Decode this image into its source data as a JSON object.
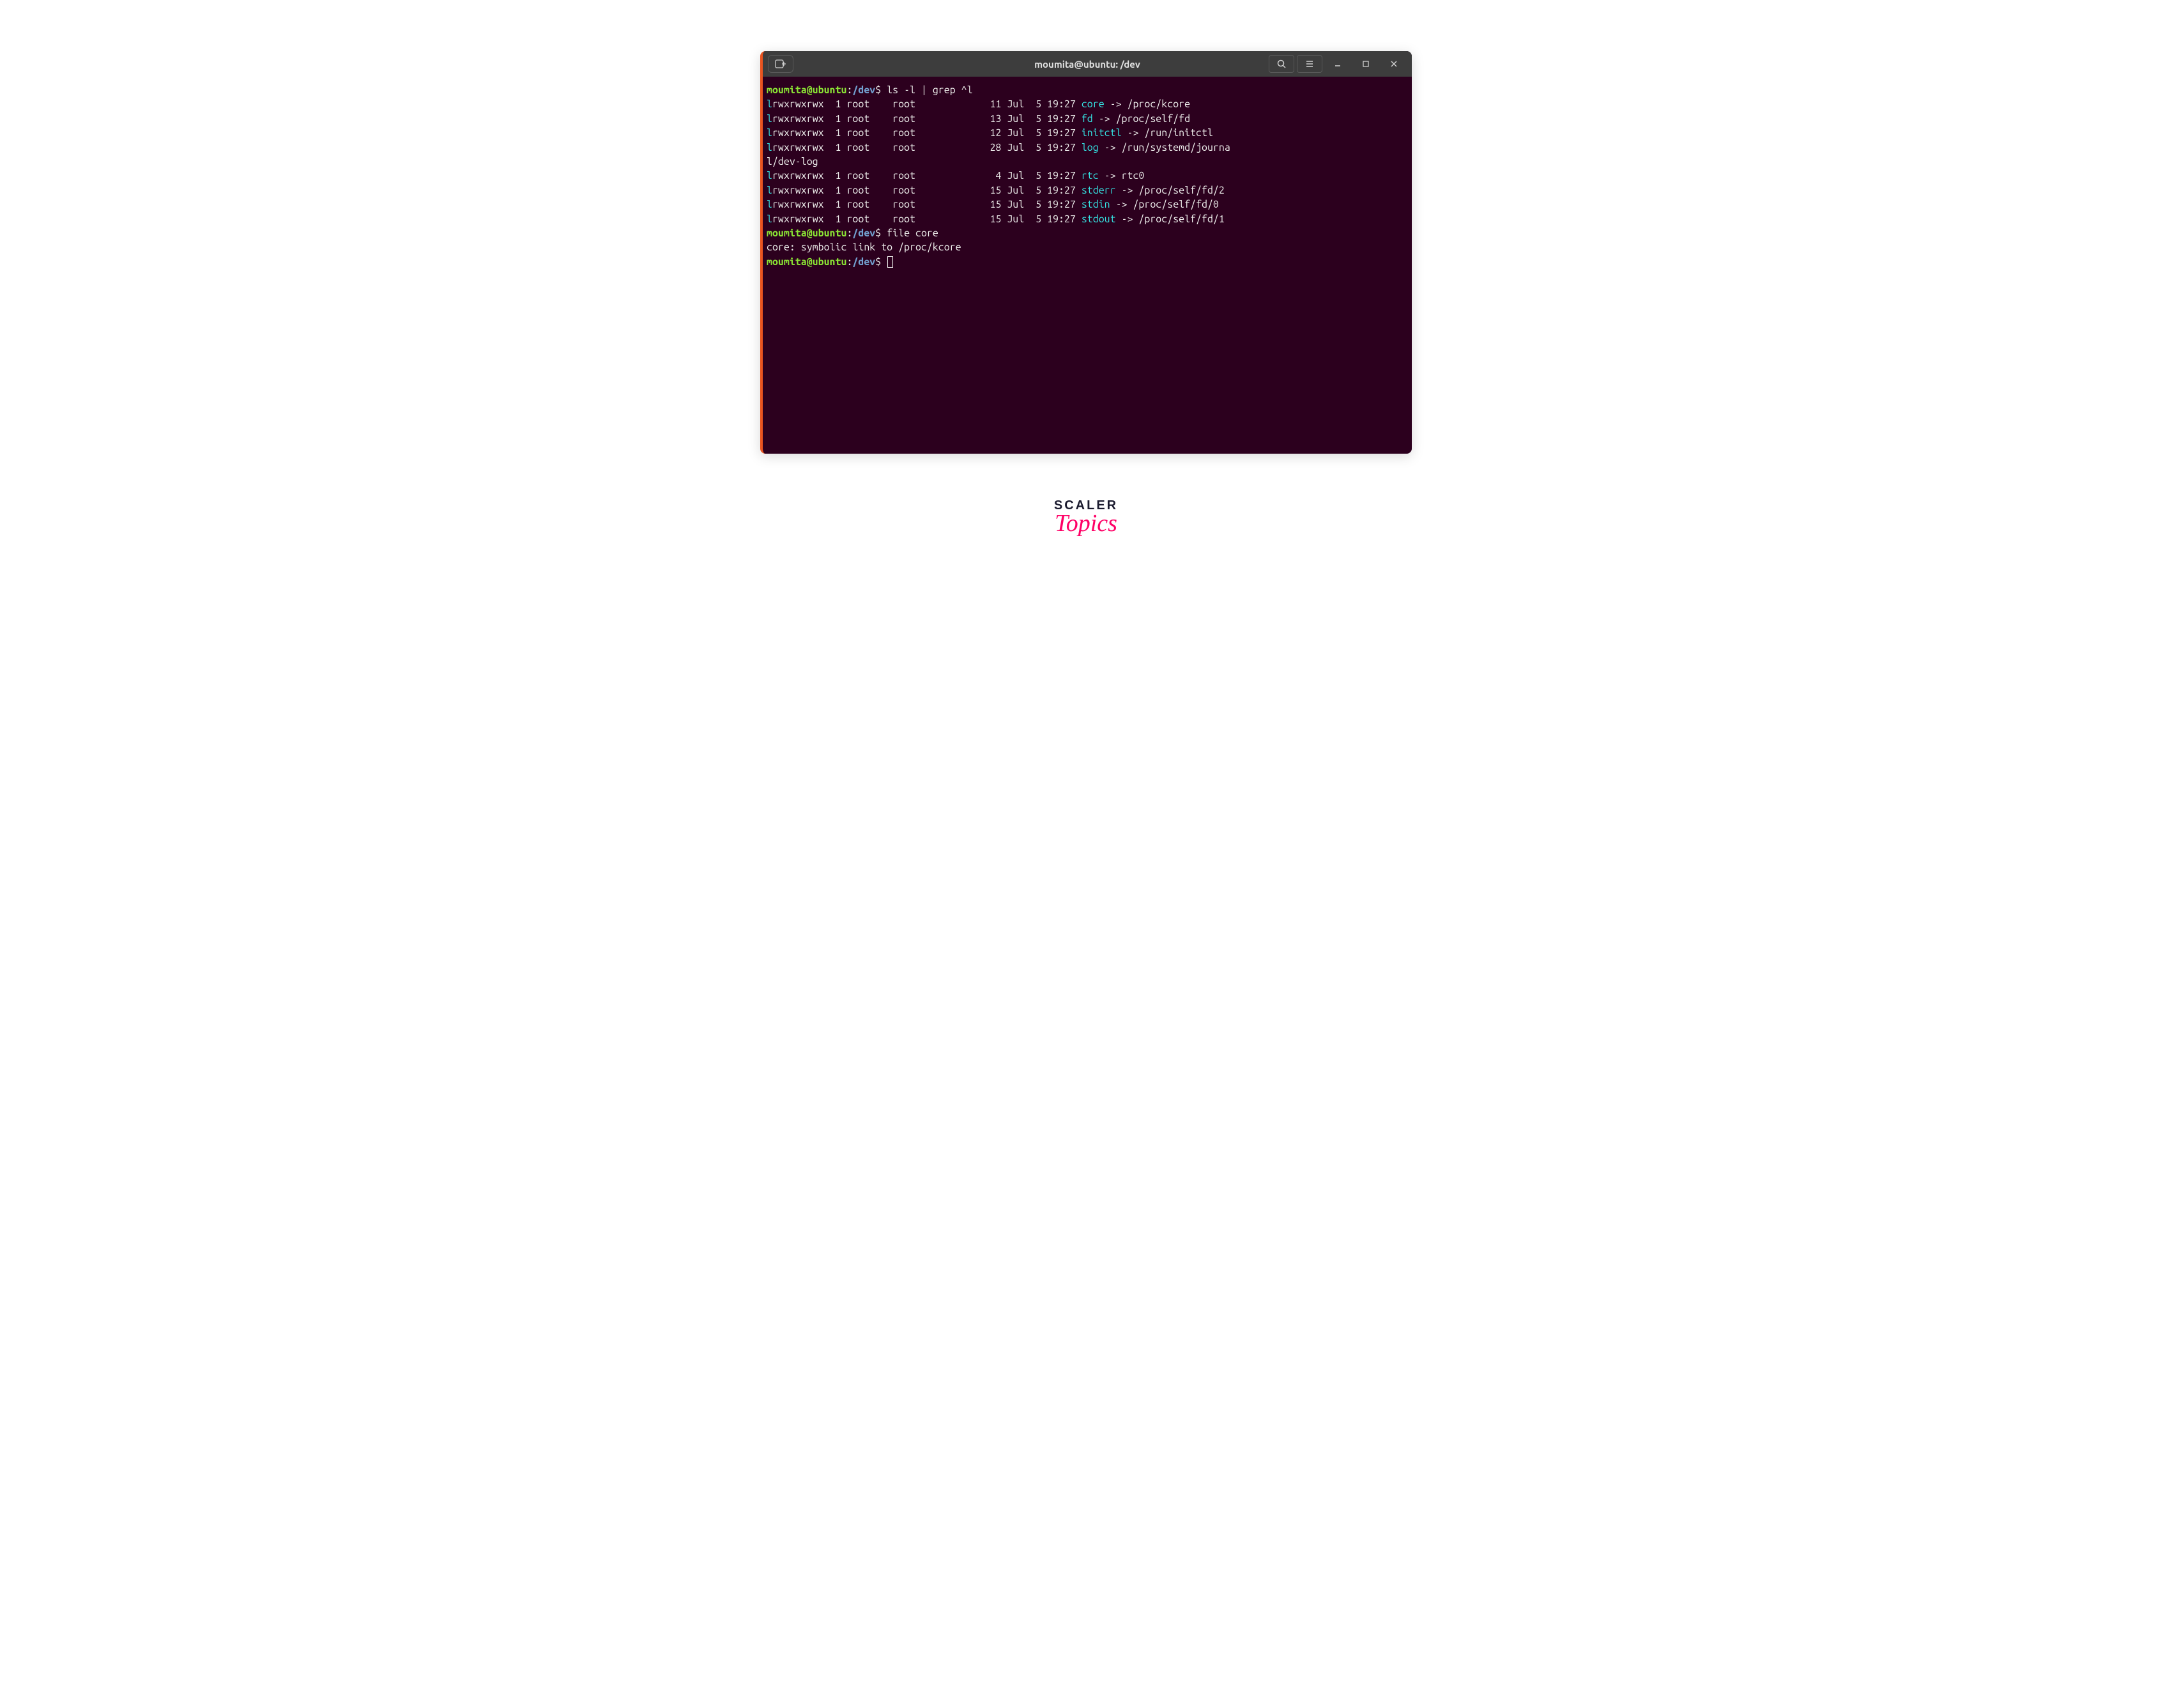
{
  "titlebar": {
    "title": "moumita@ubuntu: /dev",
    "new_tab_icon": "⊕",
    "search_icon": "🔍",
    "menu_icon": "≡",
    "minimize_icon": "—",
    "maximize_icon": "□",
    "close_icon": "✕"
  },
  "prompt": {
    "user_host": "moumita@ubuntu",
    "colon": ":",
    "path": "/dev",
    "dollar": "$"
  },
  "commands": {
    "cmd1": "ls -l | grep ^l",
    "cmd2": "file core"
  },
  "ls_rows": [
    {
      "type": "l",
      "perms": "rwxrwxrwx",
      "links": "1",
      "owner": "root",
      "group": "root",
      "size": "11",
      "month": "Jul",
      "day": "5",
      "time": "19:27",
      "name": "core",
      "arrow": "->",
      "target": "/proc/kcore"
    },
    {
      "type": "l",
      "perms": "rwxrwxrwx",
      "links": "1",
      "owner": "root",
      "group": "root",
      "size": "13",
      "month": "Jul",
      "day": "5",
      "time": "19:27",
      "name": "fd",
      "arrow": "->",
      "target": "/proc/self/fd"
    },
    {
      "type": "l",
      "perms": "rwxrwxrwx",
      "links": "1",
      "owner": "root",
      "group": "root",
      "size": "12",
      "month": "Jul",
      "day": "5",
      "time": "19:27",
      "name": "initctl",
      "arrow": "->",
      "target": "/run/initctl"
    },
    {
      "type": "l",
      "perms": "rwxrwxrwx",
      "links": "1",
      "owner": "root",
      "group": "root",
      "size": "28",
      "month": "Jul",
      "day": "5",
      "time": "19:27",
      "name": "log",
      "arrow": "->",
      "target": "/run/systemd/journa",
      "wrap": "l/dev-log"
    },
    {
      "type": "l",
      "perms": "rwxrwxrwx",
      "links": "1",
      "owner": "root",
      "group": "root",
      "size": "4",
      "month": "Jul",
      "day": "5",
      "time": "19:27",
      "name": "rtc",
      "arrow": "->",
      "target": "rtc0"
    },
    {
      "type": "l",
      "perms": "rwxrwxrwx",
      "links": "1",
      "owner": "root",
      "group": "root",
      "size": "15",
      "month": "Jul",
      "day": "5",
      "time": "19:27",
      "name": "stderr",
      "arrow": "->",
      "target": "/proc/self/fd/2"
    },
    {
      "type": "l",
      "perms": "rwxrwxrwx",
      "links": "1",
      "owner": "root",
      "group": "root",
      "size": "15",
      "month": "Jul",
      "day": "5",
      "time": "19:27",
      "name": "stdin",
      "arrow": "->",
      "target": "/proc/self/fd/0"
    },
    {
      "type": "l",
      "perms": "rwxrwxrwx",
      "links": "1",
      "owner": "root",
      "group": "root",
      "size": "15",
      "month": "Jul",
      "day": "5",
      "time": "19:27",
      "name": "stdout",
      "arrow": "->",
      "target": "/proc/self/fd/1"
    }
  ],
  "file_output": "core: symbolic link to /proc/kcore",
  "logo": {
    "line1": "SCALER",
    "line2": "Topics"
  }
}
